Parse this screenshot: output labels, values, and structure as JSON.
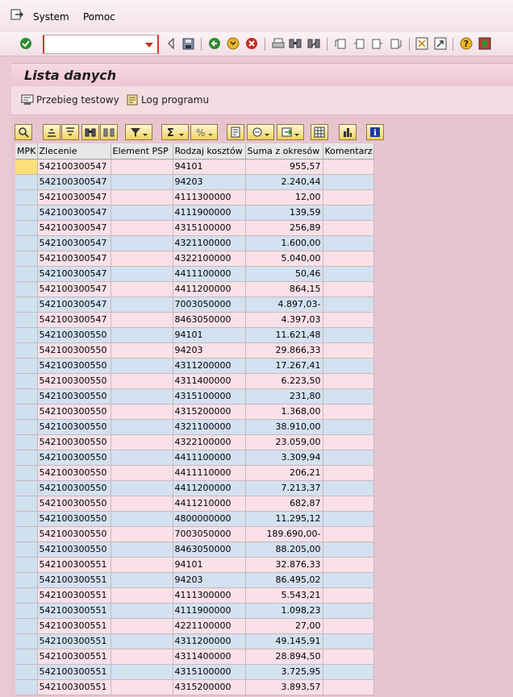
{
  "menu": {
    "system": "System",
    "pomoc": "Pomoc"
  },
  "toolbar": {
    "command_value": ""
  },
  "title": "Lista danych",
  "app_toolbar": {
    "test_run": "Przebieg testowy",
    "log": "Log programu"
  },
  "columns": [
    "MPK",
    "Zlecenie",
    "Element PSP",
    "Rodzaj kosztów",
    "Suma z okresów",
    "Komentarz"
  ],
  "rows": [
    [
      "",
      "542100300547",
      "",
      "94101",
      "955,57",
      ""
    ],
    [
      "",
      "542100300547",
      "",
      "94203",
      "2.240,44",
      ""
    ],
    [
      "",
      "542100300547",
      "",
      "4111300000",
      "12,00",
      ""
    ],
    [
      "",
      "542100300547",
      "",
      "4111900000",
      "139,59",
      ""
    ],
    [
      "",
      "542100300547",
      "",
      "4315100000",
      "256,89",
      ""
    ],
    [
      "",
      "542100300547",
      "",
      "4321100000",
      "1.600,00",
      ""
    ],
    [
      "",
      "542100300547",
      "",
      "4322100000",
      "5.040,00",
      ""
    ],
    [
      "",
      "542100300547",
      "",
      "4411100000",
      "50,46",
      ""
    ],
    [
      "",
      "542100300547",
      "",
      "4411200000",
      "864,15",
      ""
    ],
    [
      "",
      "542100300547",
      "",
      "7003050000",
      "4.897,03-",
      ""
    ],
    [
      "",
      "542100300547",
      "",
      "8463050000",
      "4.397,03",
      ""
    ],
    [
      "",
      "542100300550",
      "",
      "94101",
      "11.621,48",
      ""
    ],
    [
      "",
      "542100300550",
      "",
      "94203",
      "29.866,33",
      ""
    ],
    [
      "",
      "542100300550",
      "",
      "4311200000",
      "17.267,41",
      ""
    ],
    [
      "",
      "542100300550",
      "",
      "4311400000",
      "6.223,50",
      ""
    ],
    [
      "",
      "542100300550",
      "",
      "4315100000",
      "231,80",
      ""
    ],
    [
      "",
      "542100300550",
      "",
      "4315200000",
      "1.368,00",
      ""
    ],
    [
      "",
      "542100300550",
      "",
      "4321100000",
      "38.910,00",
      ""
    ],
    [
      "",
      "542100300550",
      "",
      "4322100000",
      "23.059,00",
      ""
    ],
    [
      "",
      "542100300550",
      "",
      "4411100000",
      "3.309,94",
      ""
    ],
    [
      "",
      "542100300550",
      "",
      "4411110000",
      "206,21",
      ""
    ],
    [
      "",
      "542100300550",
      "",
      "4411200000",
      "7.213,37",
      ""
    ],
    [
      "",
      "542100300550",
      "",
      "4411210000",
      "682,87",
      ""
    ],
    [
      "",
      "542100300550",
      "",
      "4800000000",
      "11.295,12",
      ""
    ],
    [
      "",
      "542100300550",
      "",
      "7003050000",
      "189.690,00-",
      ""
    ],
    [
      "",
      "542100300550",
      "",
      "8463050000",
      "88.205,00",
      ""
    ],
    [
      "",
      "542100300551",
      "",
      "94101",
      "32.876,33",
      ""
    ],
    [
      "",
      "542100300551",
      "",
      "94203",
      "86.495,02",
      ""
    ],
    [
      "",
      "542100300551",
      "",
      "4111300000",
      "5.543,21",
      ""
    ],
    [
      "",
      "542100300551",
      "",
      "4111900000",
      "1.098,23",
      ""
    ],
    [
      "",
      "542100300551",
      "",
      "4221100000",
      "27,00",
      ""
    ],
    [
      "",
      "542100300551",
      "",
      "4311200000",
      "49.145,91",
      ""
    ],
    [
      "",
      "542100300551",
      "",
      "4311400000",
      "28.894,50",
      ""
    ],
    [
      "",
      "542100300551",
      "",
      "4315100000",
      "3.725,95",
      ""
    ],
    [
      "",
      "542100300551",
      "",
      "4315200000",
      "3.893,57",
      ""
    ]
  ]
}
